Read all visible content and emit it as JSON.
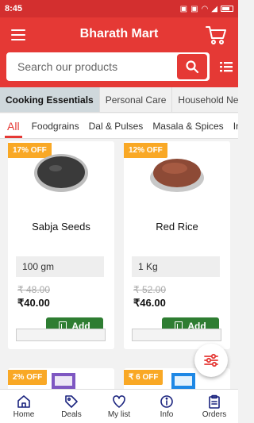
{
  "status_bar": {
    "time": "8:45"
  },
  "header": {
    "title": "Bharath Mart"
  },
  "search": {
    "placeholder": "Search our products"
  },
  "categories": [
    {
      "label": "Cooking Essentials",
      "active": true
    },
    {
      "label": "Personal Care",
      "active": false
    },
    {
      "label": "Household Needs",
      "active": false
    }
  ],
  "subcategories": [
    {
      "label": "All",
      "active": true
    },
    {
      "label": "Foodgrains",
      "active": false
    },
    {
      "label": "Dal & Pulses",
      "active": false
    },
    {
      "label": "Masala & Spices",
      "active": false
    },
    {
      "label": "Ins",
      "active": false
    }
  ],
  "products": [
    {
      "badge": "17% OFF",
      "name": "Sabja Seeds",
      "quantity": "100 gm",
      "mrp": "₹ 48.00",
      "price": "₹40.00",
      "add_label": "Add"
    },
    {
      "badge": "12% OFF",
      "name": "Red Rice",
      "quantity": "1 Kg",
      "mrp": "₹ 52.00",
      "price": "₹46.00",
      "add_label": "Add"
    },
    {
      "badge": "2% OFF"
    },
    {
      "badge": "₹ 6 OFF"
    }
  ],
  "bottom_nav": [
    {
      "label": "Home",
      "icon": "home-icon"
    },
    {
      "label": "Deals",
      "icon": "tag-icon"
    },
    {
      "label": "My list",
      "icon": "heart-icon"
    },
    {
      "label": "Info",
      "icon": "info-icon"
    },
    {
      "label": "Orders",
      "icon": "clipboard-icon"
    }
  ],
  "colors": {
    "primary": "#e53935",
    "badge": "#f9a825",
    "add_button": "#2e7d32"
  }
}
